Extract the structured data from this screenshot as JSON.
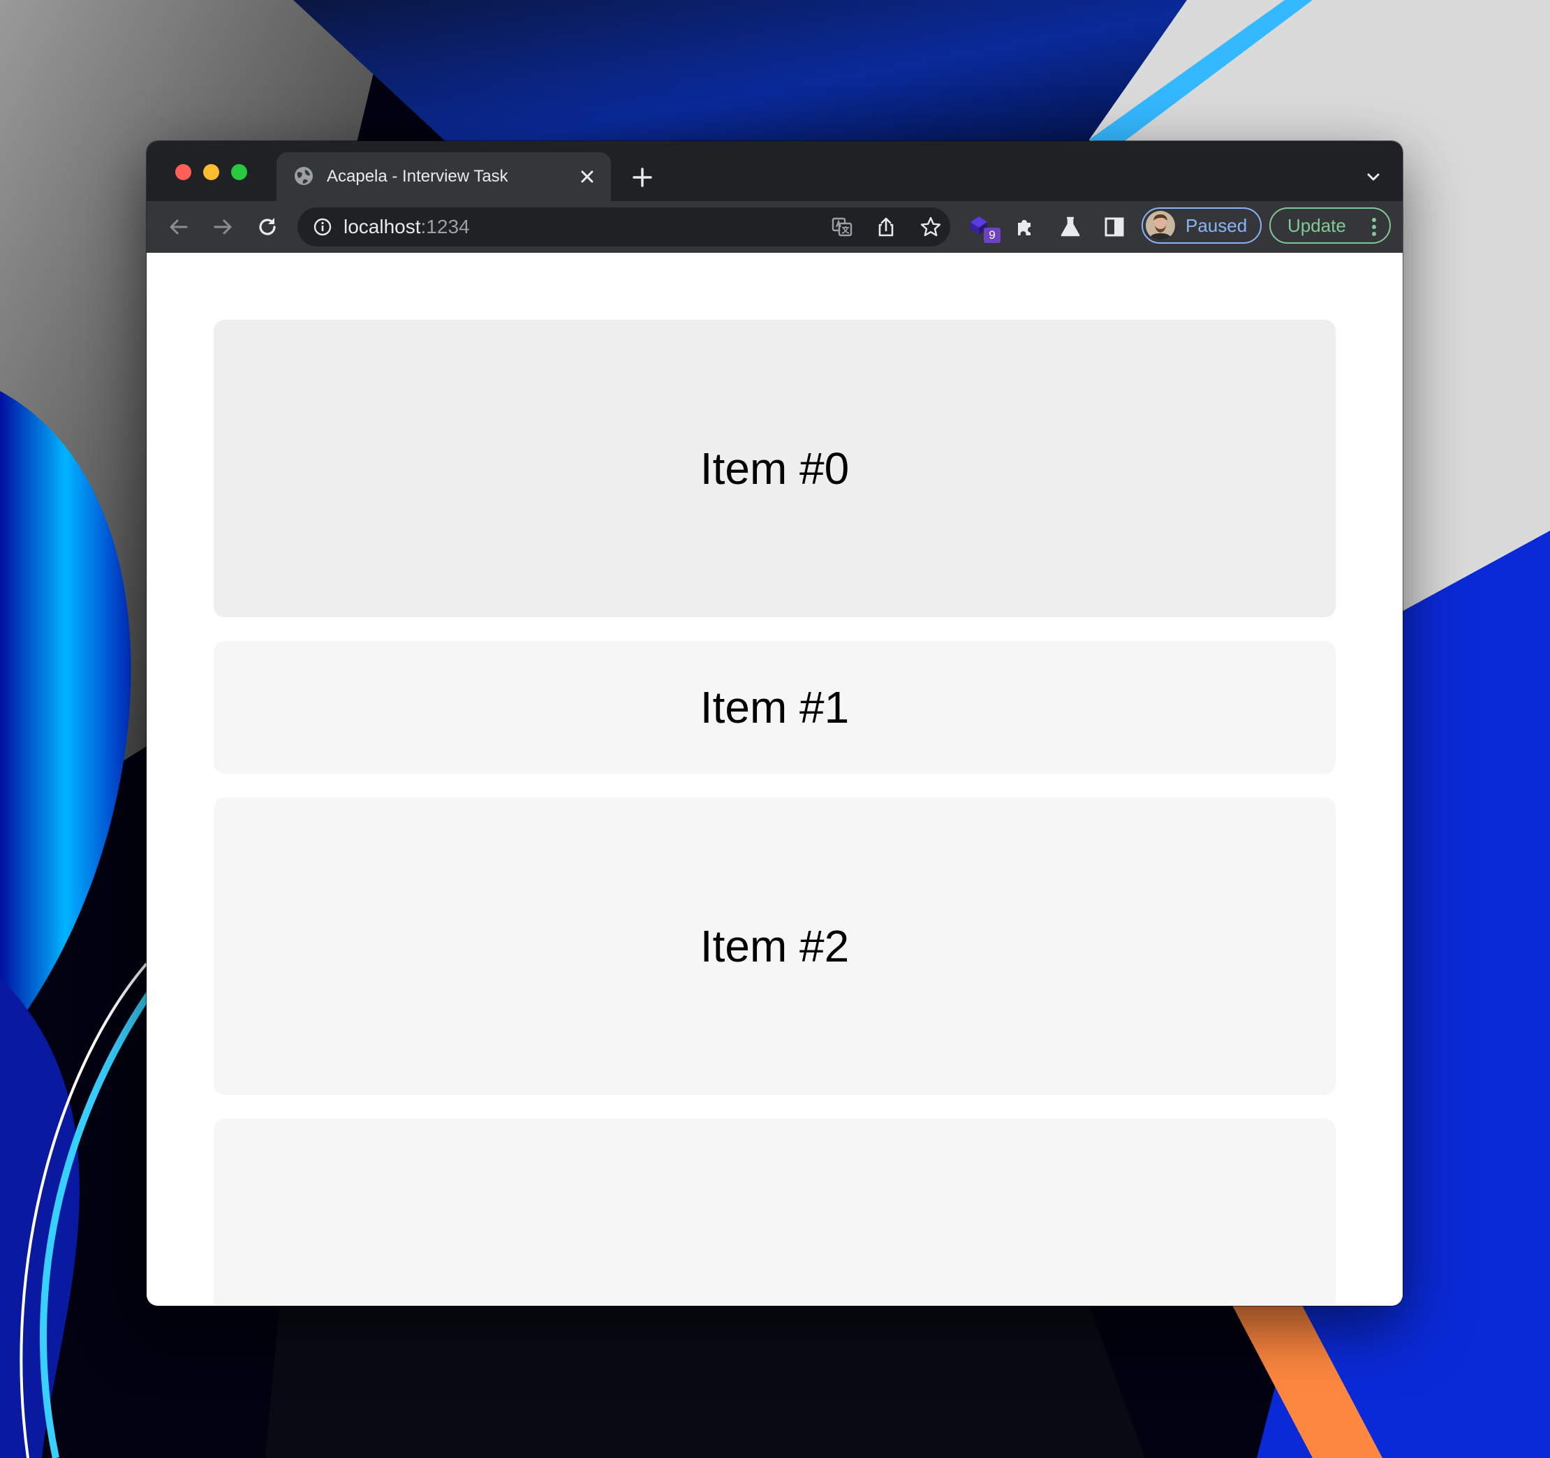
{
  "window": {
    "tab_title": "Acapela - Interview Task",
    "url_host": "localhost",
    "url_port": ":1234"
  },
  "toolbar": {
    "extension_badge": "9",
    "profile_status": "Paused",
    "update_label": "Update"
  },
  "icons": {
    "favicon": "globe-icon",
    "tab_close": "close-icon",
    "new_tab": "plus-icon",
    "tab_search": "chevron-down-icon",
    "back": "arrow-left-icon",
    "forward": "arrow-right-icon",
    "reload": "reload-icon",
    "site_info": "info-icon",
    "translate": "translate-icon",
    "share": "share-icon",
    "bookmark": "star-icon",
    "extension": "cube-stack-icon",
    "extensions_menu": "puzzle-icon",
    "labs": "flask-icon",
    "side_panel": "side-panel-icon",
    "more": "vertical-dots-icon"
  },
  "colors": {
    "tab_strip": "#202124",
    "toolbar": "#35363a",
    "profile_accent": "#8ab4f8",
    "update_accent": "#81c995",
    "card_active": "#eeeeee",
    "card": "#f6f6f6"
  },
  "page": {
    "items": [
      {
        "label": "Item #0"
      },
      {
        "label": "Item #1"
      },
      {
        "label": "Item #2"
      },
      {
        "label": ""
      }
    ]
  }
}
